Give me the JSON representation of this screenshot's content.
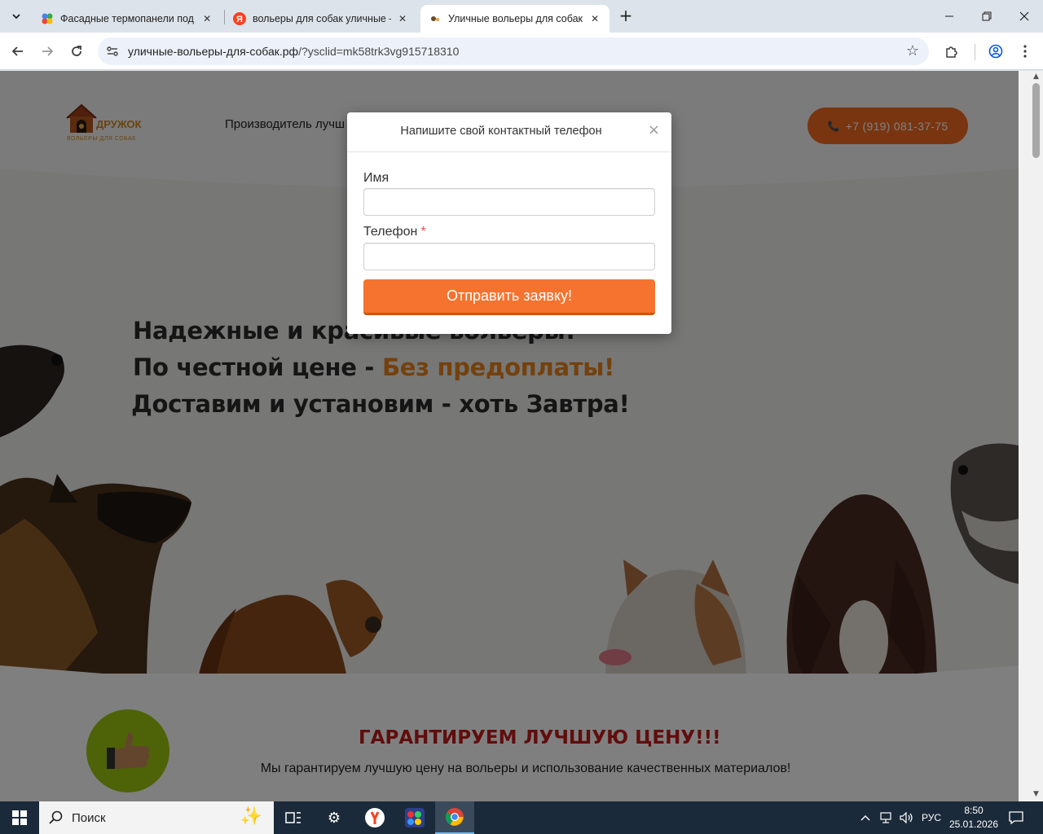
{
  "browser": {
    "tabs": [
      {
        "title": "Фасадные термопанели под к",
        "favicon": "colorful-dots-favicon"
      },
      {
        "title": "вольеры для собак уличные –",
        "favicon": "yandex-favicon"
      },
      {
        "title": "Уличные вольеры для собак М",
        "favicon": "site-favicon",
        "active": true
      }
    ],
    "url_host": "уличные-вольеры-для-собак.рф",
    "url_rest": "/?ysclid=mk58trk3vg915718310"
  },
  "site": {
    "logo_text": "ДРУЖОК",
    "logo_sub": "ВОЛЬЕРЫ ДЛЯ СОБАК",
    "nav_text": "Производитель лучш",
    "phone": "+7 (919) 081-37-75",
    "headline": {
      "line1": "Надежные и красивые вольеры!",
      "line2_prefix": "По честной цене - ",
      "line2_accent": "Без предоплаты!",
      "line3": "Доставим и установим - хоть Завтра!"
    },
    "guarantee_title": "ГАРАНТИРУЕМ ЛУЧШУЮ ЦЕНУ!!!",
    "guarantee_text": "Мы гарантируем лучшую цену на вольеры и использование качественных материалов!",
    "accent_color": "#f26b21"
  },
  "modal": {
    "title": "Напишите свой контактный телефон",
    "close": "×",
    "name_label": "Имя",
    "name_value": "",
    "phone_label": "Телефон",
    "phone_required": "*",
    "phone_value": "",
    "submit_label": "Отправить заявку!"
  },
  "taskbar": {
    "search_placeholder": "Поиск",
    "lang": "РУС",
    "time": "8:50",
    "date": "25.01.2026"
  }
}
